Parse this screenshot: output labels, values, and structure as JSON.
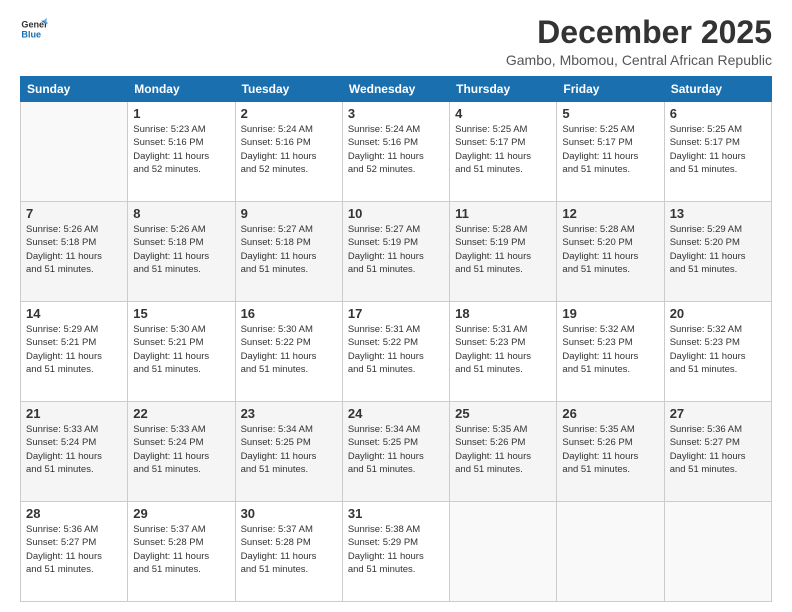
{
  "logo": {
    "line1": "General",
    "line2": "Blue"
  },
  "title": "December 2025",
  "subtitle": "Gambo, Mbomou, Central African Republic",
  "days_header": [
    "Sunday",
    "Monday",
    "Tuesday",
    "Wednesday",
    "Thursday",
    "Friday",
    "Saturday"
  ],
  "weeks": [
    [
      {
        "day": "",
        "info": ""
      },
      {
        "day": "1",
        "info": "Sunrise: 5:23 AM\nSunset: 5:16 PM\nDaylight: 11 hours\nand 52 minutes."
      },
      {
        "day": "2",
        "info": "Sunrise: 5:24 AM\nSunset: 5:16 PM\nDaylight: 11 hours\nand 52 minutes."
      },
      {
        "day": "3",
        "info": "Sunrise: 5:24 AM\nSunset: 5:16 PM\nDaylight: 11 hours\nand 52 minutes."
      },
      {
        "day": "4",
        "info": "Sunrise: 5:25 AM\nSunset: 5:17 PM\nDaylight: 11 hours\nand 51 minutes."
      },
      {
        "day": "5",
        "info": "Sunrise: 5:25 AM\nSunset: 5:17 PM\nDaylight: 11 hours\nand 51 minutes."
      },
      {
        "day": "6",
        "info": "Sunrise: 5:25 AM\nSunset: 5:17 PM\nDaylight: 11 hours\nand 51 minutes."
      }
    ],
    [
      {
        "day": "7",
        "info": "Sunrise: 5:26 AM\nSunset: 5:18 PM\nDaylight: 11 hours\nand 51 minutes."
      },
      {
        "day": "8",
        "info": "Sunrise: 5:26 AM\nSunset: 5:18 PM\nDaylight: 11 hours\nand 51 minutes."
      },
      {
        "day": "9",
        "info": "Sunrise: 5:27 AM\nSunset: 5:18 PM\nDaylight: 11 hours\nand 51 minutes."
      },
      {
        "day": "10",
        "info": "Sunrise: 5:27 AM\nSunset: 5:19 PM\nDaylight: 11 hours\nand 51 minutes."
      },
      {
        "day": "11",
        "info": "Sunrise: 5:28 AM\nSunset: 5:19 PM\nDaylight: 11 hours\nand 51 minutes."
      },
      {
        "day": "12",
        "info": "Sunrise: 5:28 AM\nSunset: 5:20 PM\nDaylight: 11 hours\nand 51 minutes."
      },
      {
        "day": "13",
        "info": "Sunrise: 5:29 AM\nSunset: 5:20 PM\nDaylight: 11 hours\nand 51 minutes."
      }
    ],
    [
      {
        "day": "14",
        "info": "Sunrise: 5:29 AM\nSunset: 5:21 PM\nDaylight: 11 hours\nand 51 minutes."
      },
      {
        "day": "15",
        "info": "Sunrise: 5:30 AM\nSunset: 5:21 PM\nDaylight: 11 hours\nand 51 minutes."
      },
      {
        "day": "16",
        "info": "Sunrise: 5:30 AM\nSunset: 5:22 PM\nDaylight: 11 hours\nand 51 minutes."
      },
      {
        "day": "17",
        "info": "Sunrise: 5:31 AM\nSunset: 5:22 PM\nDaylight: 11 hours\nand 51 minutes."
      },
      {
        "day": "18",
        "info": "Sunrise: 5:31 AM\nSunset: 5:23 PM\nDaylight: 11 hours\nand 51 minutes."
      },
      {
        "day": "19",
        "info": "Sunrise: 5:32 AM\nSunset: 5:23 PM\nDaylight: 11 hours\nand 51 minutes."
      },
      {
        "day": "20",
        "info": "Sunrise: 5:32 AM\nSunset: 5:23 PM\nDaylight: 11 hours\nand 51 minutes."
      }
    ],
    [
      {
        "day": "21",
        "info": "Sunrise: 5:33 AM\nSunset: 5:24 PM\nDaylight: 11 hours\nand 51 minutes."
      },
      {
        "day": "22",
        "info": "Sunrise: 5:33 AM\nSunset: 5:24 PM\nDaylight: 11 hours\nand 51 minutes."
      },
      {
        "day": "23",
        "info": "Sunrise: 5:34 AM\nSunset: 5:25 PM\nDaylight: 11 hours\nand 51 minutes."
      },
      {
        "day": "24",
        "info": "Sunrise: 5:34 AM\nSunset: 5:25 PM\nDaylight: 11 hours\nand 51 minutes."
      },
      {
        "day": "25",
        "info": "Sunrise: 5:35 AM\nSunset: 5:26 PM\nDaylight: 11 hours\nand 51 minutes."
      },
      {
        "day": "26",
        "info": "Sunrise: 5:35 AM\nSunset: 5:26 PM\nDaylight: 11 hours\nand 51 minutes."
      },
      {
        "day": "27",
        "info": "Sunrise: 5:36 AM\nSunset: 5:27 PM\nDaylight: 11 hours\nand 51 minutes."
      }
    ],
    [
      {
        "day": "28",
        "info": "Sunrise: 5:36 AM\nSunset: 5:27 PM\nDaylight: 11 hours\nand 51 minutes."
      },
      {
        "day": "29",
        "info": "Sunrise: 5:37 AM\nSunset: 5:28 PM\nDaylight: 11 hours\nand 51 minutes."
      },
      {
        "day": "30",
        "info": "Sunrise: 5:37 AM\nSunset: 5:28 PM\nDaylight: 11 hours\nand 51 minutes."
      },
      {
        "day": "31",
        "info": "Sunrise: 5:38 AM\nSunset: 5:29 PM\nDaylight: 11 hours\nand 51 minutes."
      },
      {
        "day": "",
        "info": ""
      },
      {
        "day": "",
        "info": ""
      },
      {
        "day": "",
        "info": ""
      }
    ]
  ]
}
